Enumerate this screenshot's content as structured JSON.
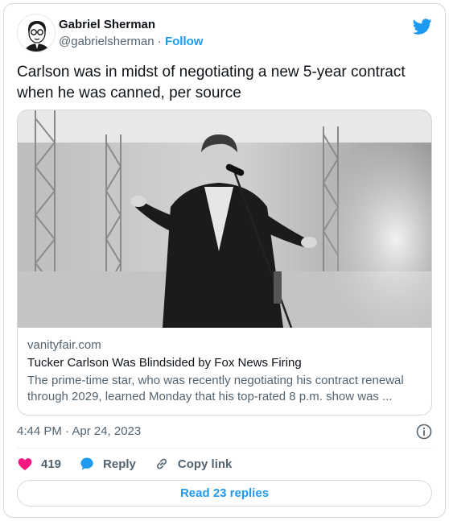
{
  "author": {
    "name": "Gabriel Sherman",
    "handle": "@gabrielsherman",
    "separator": "·",
    "follow_label": "Follow"
  },
  "tweet": {
    "text": "Carlson was in midst of negotiating a new 5-year contract when he was canned, per source",
    "timestamp": "4:44 PM · Apr 24, 2023"
  },
  "link_card": {
    "domain": "vanityfair.com",
    "title": "Tucker Carlson Was Blindsided by Fox News Firing",
    "description": "The prime-time star, who was recently negotiating his contract renewal through 2029, learned Monday that his top-rated 8 p.m. show was ..."
  },
  "actions": {
    "like_count": "419",
    "reply_label": "Reply",
    "copy_link_label": "Copy link"
  },
  "read_replies_label": "Read 23 replies",
  "colors": {
    "accent": "#1d9bf0",
    "like": "#f91880",
    "text": "#0f1419",
    "muted": "#536471"
  },
  "icons": [
    "twitter-bird-icon",
    "info-icon",
    "heart-icon",
    "reply-bubble-icon",
    "link-icon"
  ]
}
